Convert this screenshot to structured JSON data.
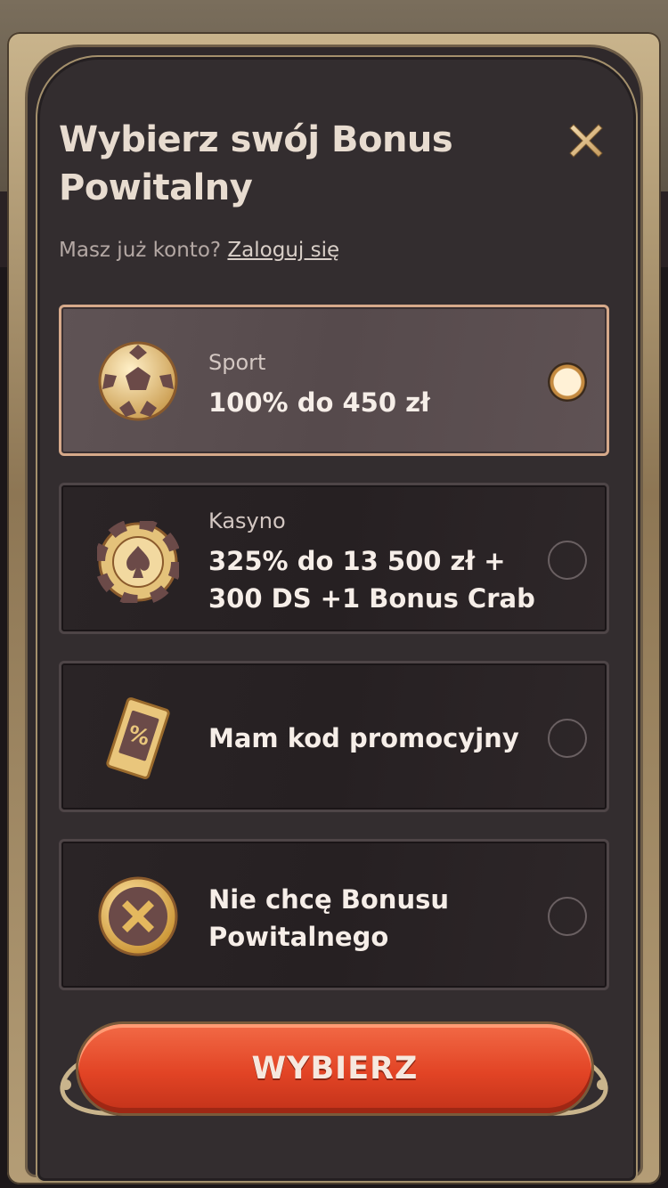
{
  "modal": {
    "title": "Wybierz swój Bonus Powitalny",
    "close_icon": "close-icon",
    "login_prompt": "Masz już konto?",
    "login_link": "Zaloguj się"
  },
  "options": [
    {
      "label": "Sport",
      "value": "100% do 450 zł",
      "icon": "soccer-ball-icon",
      "selected": true
    },
    {
      "label": "Kasyno",
      "value": "325% do 13 500 zł + 300 DS +1 Bonus Crab",
      "icon": "casino-chip-icon",
      "selected": false
    },
    {
      "label": "",
      "value": "Mam kod promocyjny",
      "icon": "promo-ticket-icon",
      "selected": false
    },
    {
      "label": "",
      "value": "Nie chcę Bonusu Powitalnego",
      "icon": "no-bonus-icon",
      "selected": false
    }
  ],
  "cta": {
    "label": "WYBIERZ"
  },
  "colors": {
    "accent_gold": "#d6a98a",
    "cta_red": "#e24425",
    "panel_bg": "#332d2f"
  }
}
